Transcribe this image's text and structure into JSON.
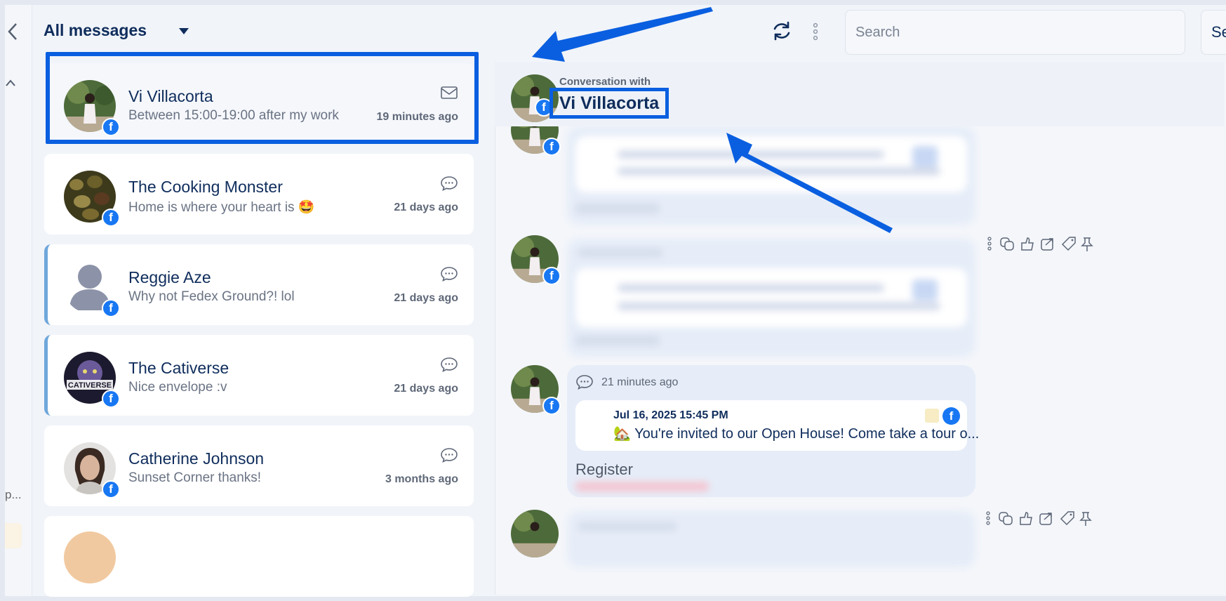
{
  "header": {
    "title": "All messages",
    "search_placeholder": "Search",
    "search_button_label": "Se"
  },
  "rail": {
    "truncated_label": "p..."
  },
  "conversations": [
    {
      "name": "Vi Villacorta",
      "preview": "Between 15:00-19:00 after my work",
      "time": "19 minutes ago",
      "type": "email",
      "source": "facebook"
    },
    {
      "name": "The Cooking Monster",
      "preview": "Home is where your heart is 🤩",
      "time": "21 days ago",
      "type": "chat",
      "source": "facebook"
    },
    {
      "name": "Reggie Aze",
      "preview": "Why not Fedex Ground?! lol",
      "time": "21 days ago",
      "type": "chat",
      "source": "facebook"
    },
    {
      "name": "The Cativerse",
      "preview": "Nice envelope :v",
      "time": "21 days ago",
      "type": "chat",
      "source": "facebook"
    },
    {
      "name": "Catherine Johnson",
      "preview": "Sunset Corner thanks!",
      "time": "3 months ago",
      "type": "chat",
      "source": "facebook"
    }
  ],
  "conversation_pane": {
    "label": "Conversation with",
    "name": "Vi Villacorta",
    "message": {
      "time": "21 minutes ago",
      "post_date": "Jul 16, 2025 15:45 PM",
      "post_text": "🏡 You're invited to our Open House! Come take a tour o...",
      "cta": "Register"
    }
  },
  "colors": {
    "accent": "#0a5fe0",
    "facebook": "#1877f2",
    "title": "#0f2d5c"
  }
}
